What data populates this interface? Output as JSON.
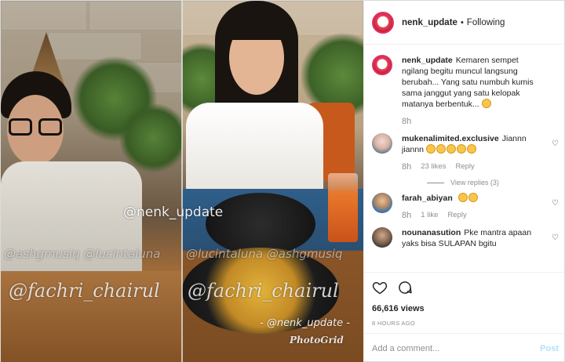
{
  "media": {
    "watermark_main": "@nenk_update",
    "watermark_faint_left": "@ashgmusiq @lucintaluna",
    "watermark_faint_right": "@lucintaluna @ashgmusiq",
    "watermark_script_left": "@fachri_chairul",
    "watermark_script_right": "@fachri_chairul",
    "watermark_credit": "- @nenk_update -",
    "watermark_app": "PhotoGrid"
  },
  "header": {
    "username": "nenk_update",
    "separator": "•",
    "follow_status": "Following"
  },
  "caption": {
    "username": "nenk_update",
    "text": "Kemaren sempet ngilang begitu muncul langsung berubah... Yang satu numbuh kumis sama janggut yang satu kelopak matanya berbentuk...",
    "time": "8h"
  },
  "comments": [
    {
      "username": "mukenalimited.exclusive",
      "text": "Jiannn jiannn",
      "emoji_count": 5,
      "time": "8h",
      "likes": "23 likes",
      "reply": "Reply",
      "view_replies": "View replies (3)"
    },
    {
      "username": "farah_abiyan",
      "text": "",
      "emoji_count": 2,
      "time": "8h",
      "likes": "1 like",
      "reply": "Reply"
    },
    {
      "username": "nounanasution",
      "text": "Pke mantra apaan yaks bisa SULAPAN bgitu"
    }
  ],
  "actions": {
    "like_icon": "heart-icon",
    "comment_icon": "comment-icon",
    "views": "66,616 views",
    "posted_ago": "8 HOURS AGO"
  },
  "add_comment": {
    "placeholder": "Add a comment...",
    "post_label": "Post"
  },
  "colors": {
    "story_ring": "#e1306c",
    "muted_text": "#8e8e8e",
    "post_disabled": "#b2dffc"
  }
}
